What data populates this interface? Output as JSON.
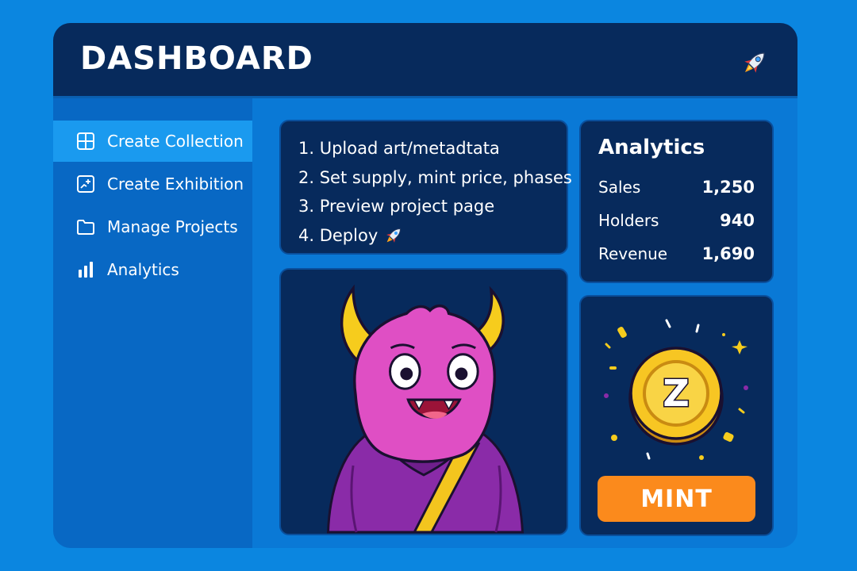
{
  "header": {
    "title": "DASHBOARD",
    "icon": "rocket-icon"
  },
  "sidebar": {
    "items": [
      {
        "label": "Create Collection",
        "icon": "grid-icon",
        "active": true
      },
      {
        "label": "Create Exhibition",
        "icon": "image-add-icon",
        "active": false
      },
      {
        "label": "Manage Projects",
        "icon": "folder-icon",
        "active": false
      },
      {
        "label": "Analytics",
        "icon": "bar-chart-icon",
        "active": false
      }
    ]
  },
  "steps": [
    "1. Upload art/metadtata",
    "2. Set supply, mint price, phases",
    "3. Preview project page",
    "4. Deploy"
  ],
  "analytics": {
    "title": "Analytics",
    "stats": [
      {
        "label": "Sales",
        "value": "1,250"
      },
      {
        "label": "Holders",
        "value": "940"
      },
      {
        "label": "Revenue",
        "value": "1,690"
      }
    ]
  },
  "artwork": {
    "subject": "horned-purple-monster-illustration"
  },
  "mint": {
    "coin_letter": "Z",
    "button_label": "MINT"
  },
  "colors": {
    "background": "#0b86e0",
    "header": "#072a5c",
    "card": "#072a5c",
    "sidebar": "#0868c4",
    "sidebar_active": "#1a9aef",
    "mint_button": "#fb8a1c",
    "coin": "#f7c623"
  }
}
